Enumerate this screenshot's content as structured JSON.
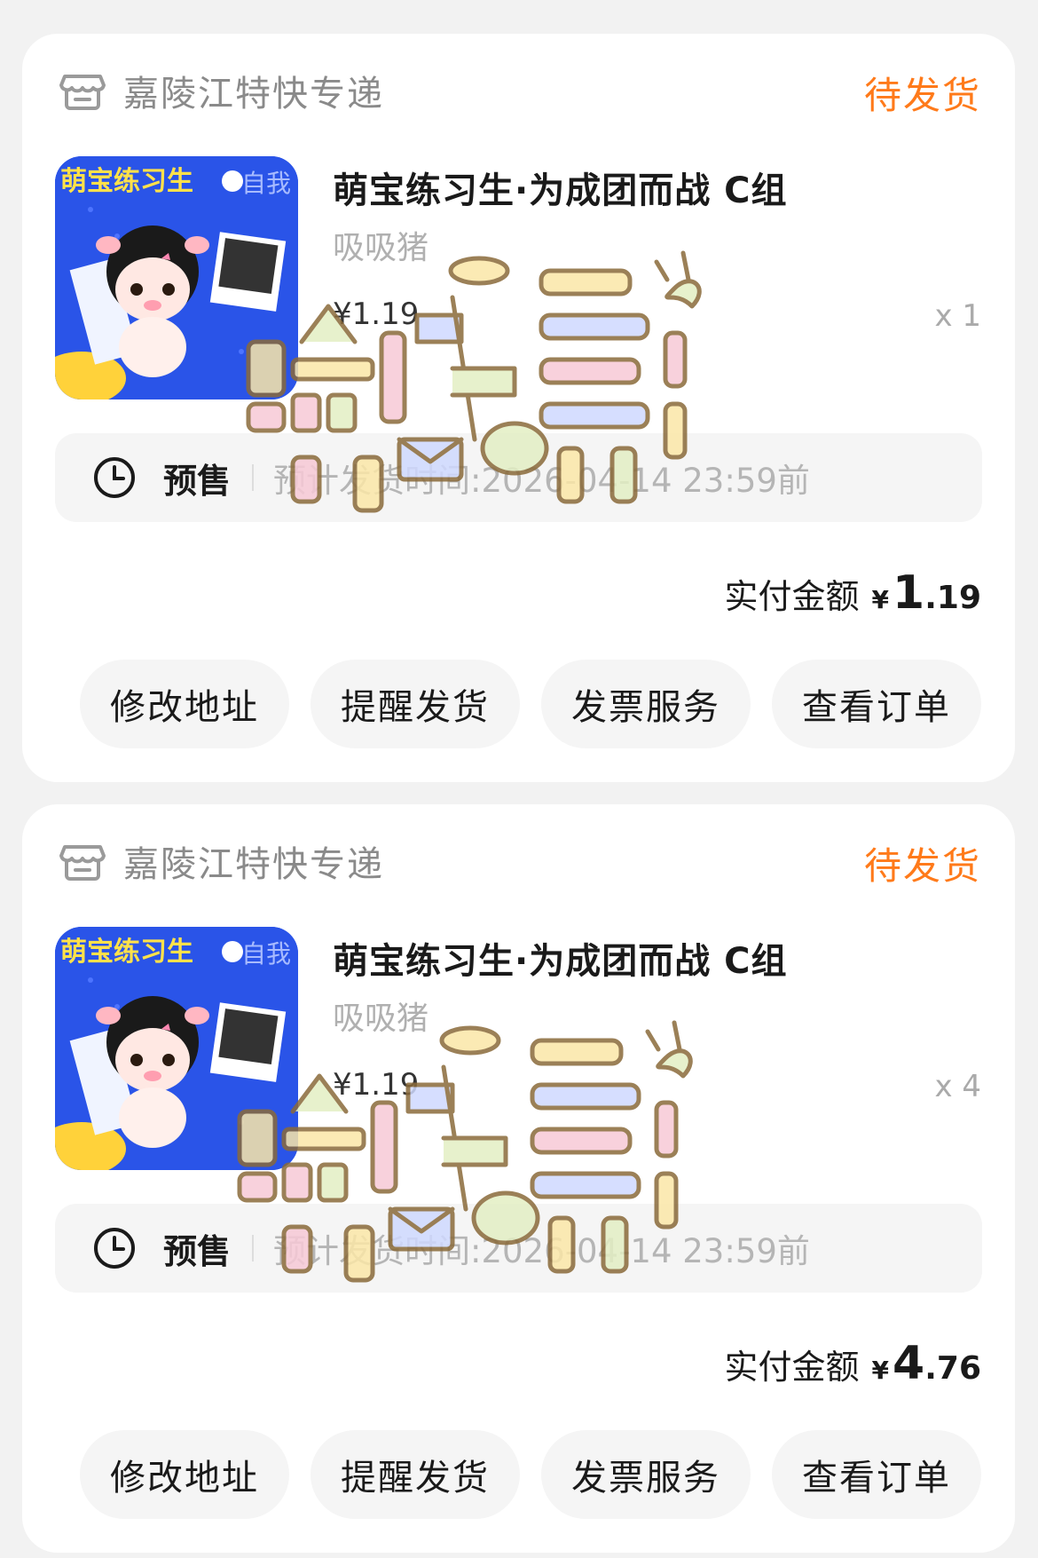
{
  "orders": [
    {
      "shop_name": "嘉陵江特快专递",
      "status": "待发货",
      "product_title": "萌宝练习生·为成团而战 C组",
      "sku": "吸吸猪",
      "unit_price": "¥1.19",
      "quantity": "x 1",
      "presale_tag": "预售",
      "presale_note": "预计发货时间:2026-04-14 23:59前",
      "total_label": "实付金额",
      "total_currency": "¥",
      "total_integer": "1",
      "total_decimal": ".19",
      "actions": [
        "修改地址",
        "提醒发货",
        "发票服务",
        "查看订单"
      ]
    },
    {
      "shop_name": "嘉陵江特快专递",
      "status": "待发货",
      "product_title": "萌宝练习生·为成团而战 C组",
      "sku": "吸吸猪",
      "unit_price": "¥1.19",
      "quantity": "x 4",
      "presale_tag": "预售",
      "presale_note": "预计发货时间:2026-04-14 23:59前",
      "total_label": "实付金额",
      "total_currency": "¥",
      "total_integer": "4",
      "total_decimal": ".76",
      "actions": [
        "修改地址",
        "提醒发货",
        "发票服务",
        "查看订单"
      ]
    }
  ],
  "thumbnail": {
    "caption": "萌宝练习生",
    "side_text": "自我"
  },
  "watermark_text": "深卜三",
  "colors": {
    "status": "#ff7a1a",
    "card_bg": "#ffffff",
    "page_bg": "#f2f2f2",
    "thumb_bg": "#2a54e8"
  },
  "icons": [
    "shop-icon",
    "clock-icon"
  ]
}
